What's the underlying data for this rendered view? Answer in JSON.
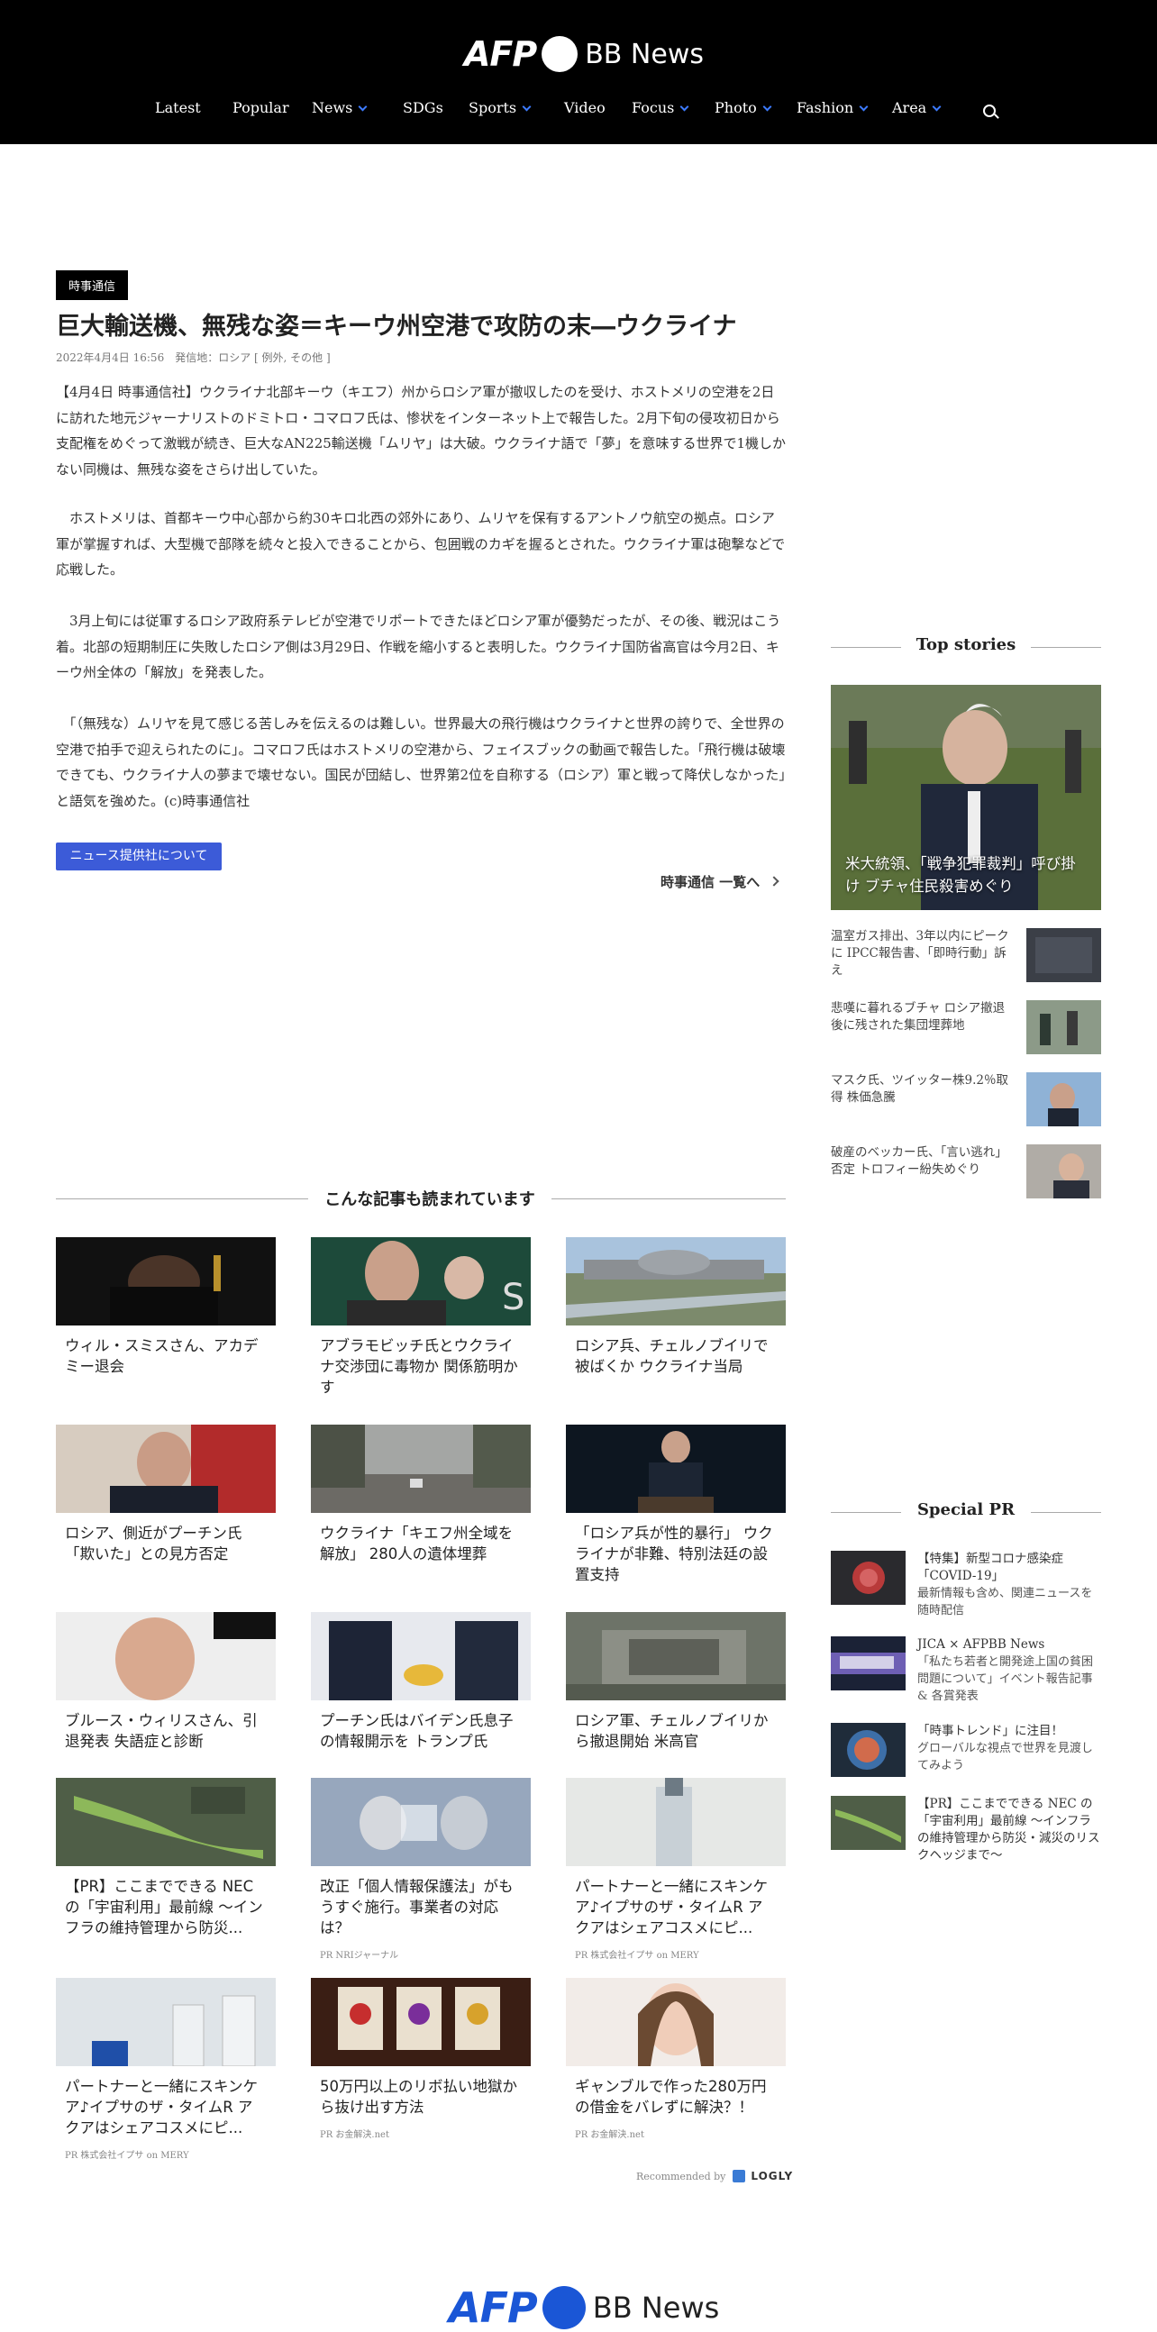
{
  "brand": {
    "afp": "AFP",
    "bb": "BB News"
  },
  "nav": [
    {
      "label": "Latest",
      "dropdown": false
    },
    {
      "label": "Popular",
      "dropdown": false
    },
    {
      "label": "News",
      "dropdown": true
    },
    {
      "label": "SDGs",
      "dropdown": false
    },
    {
      "label": "Sports",
      "dropdown": true
    },
    {
      "label": "Video",
      "dropdown": false
    },
    {
      "label": "Focus",
      "dropdown": true
    },
    {
      "label": "Photo",
      "dropdown": true
    },
    {
      "label": "Fashion",
      "dropdown": true
    },
    {
      "label": "Area",
      "dropdown": true
    }
  ],
  "article": {
    "badge": "時事通信",
    "title": "巨大輸送機、無残な姿＝キーウ州空港で攻防の末―ウクライナ",
    "meta": "2022年4月4日 16:56　発信地：ロシア [ 例外, その他 ]",
    "paragraphs": [
      "【4月4日 時事通信社】ウクライナ北部キーウ（キエフ）州からロシア軍が撤収したのを受け、ホストメリの空港を2日に訪れた地元ジャーナリストのドミトロ・コマロフ氏は、惨状をインターネット上で報告した。2月下旬の侵攻初日から支配権をめぐって激戦が続き、巨大なAN225輸送機「ムリヤ」は大破。ウクライナ語で「夢」を意味する世界で1機しかない同機は、無残な姿をさらけ出していた。",
      "　ホストメリは、首都キーウ中心部から約30キロ北西の郊外にあり、ムリヤを保有するアントノウ航空の拠点。ロシア軍が掌握すれば、大型機で部隊を続々と投入できることから、包囲戦のカギを握るとされた。ウクライナ軍は砲撃などで応戦した。",
      "　3月上旬には従軍するロシア政府系テレビが空港でリポートできたほどロシア軍が優勢だったが、その後、戦況はこう着。北部の短期制圧に失敗したロシア側は3月29日、作戦を縮小すると表明した。ウクライナ国防省高官は今月2日、キーウ州全体の「解放」を発表した。",
      "　「（無残な）ムリヤを見て感じる苦しみを伝えるのは難しい。世界最大の飛行機はウクライナと世界の誇りで、全世界の空港で拍手で迎えられたのに」。コマロフ氏はホストメリの空港から、フェイスブックの動画で報告した。「飛行機は破壊できても、ウクライナ人の夢まで壊せない。国民が団結し、世界第2位を自称する（ロシア）軍と戦って降伏しなかった」と語気を強めた。(c)時事通信社"
    ],
    "provider_button": "ニュース提供社について",
    "more_link": "時事通信 一覧へ"
  },
  "related": {
    "heading": "こんな記事も読まれています",
    "cards": [
      {
        "title": "ウィル・スミスさん、アカデミー退会",
        "source": ""
      },
      {
        "title": "アブラモビッチ氏とウクライナ交渉団に毒物か 関係筋明かす",
        "source": ""
      },
      {
        "title": "ロシア兵、チェルノブイリで被ばくか ウクライナ当局",
        "source": ""
      },
      {
        "title": "ロシア、側近がプーチン氏「欺いた」との見方否定",
        "source": ""
      },
      {
        "title": "ウクライナ「キエフ州全域を解放」 280人の遺体埋葬",
        "source": ""
      },
      {
        "title": "「ロシア兵が性的暴行」 ウクライナが非難、特別法廷の設置支持",
        "source": ""
      },
      {
        "title": "ブルース・ウィリスさん、引退発表 失語症と診断",
        "source": ""
      },
      {
        "title": "プーチン氏はバイデン氏息子の情報開示を トランプ氏",
        "source": ""
      },
      {
        "title": "ロシア軍、チェルノブイリから撤退開始 米高官",
        "source": ""
      },
      {
        "title": "【PR】ここまでできる NEC の「宇宙利用」最前線 ～インフラの維持管理から防災...",
        "source": ""
      },
      {
        "title": "改正「個人情報保護法」がもうすぐ施行。事業者の対応は？",
        "source": "PR NRIジャーナル"
      },
      {
        "title": "パートナーと一緒にスキンケア♪イプサのザ・タイムR アクアはシェアコスメにピ...",
        "source": "PR 株式会社イプサ on MERY"
      },
      {
        "title": "パートナーと一緒にスキンケア♪イプサのザ・タイムR アクアはシェアコスメにピ...",
        "source": "PR 株式会社イプサ on MERY"
      },
      {
        "title": "50万円以上のリボ払い地獄から抜け出す方法",
        "source": "PR お金解決.net"
      },
      {
        "title": "ギャンブルで作った280万円の借金をバレずに解決？！",
        "source": "PR お金解決.net"
      }
    ],
    "recommended_by": "Recommended by",
    "logly": "LOGLY"
  },
  "sidebar": {
    "top_stories_heading": "Top stories",
    "hero_caption": "米大統領、「戦争犯罪裁判」呼び掛け ブチャ住民殺害めぐり",
    "items": [
      {
        "title": "温室ガス排出、3年以内にピークに IPCC報告書、「即時行動」訴え"
      },
      {
        "title": "悲嘆に暮れるブチャ ロシア撤退後に残された集団埋葬地"
      },
      {
        "title": "マスク氏、ツイッター株9.2％取得 株価急騰"
      },
      {
        "title": "破産のベッカー氏、「言い逃れ」否定 トロフィー紛失めぐり"
      }
    ],
    "special_pr_heading": "Special PR",
    "pr_items": [
      {
        "title": "【特集】新型コロナ感染症「COVID-19」",
        "sub": "最新情報も含め、関連ニュースを随時配信"
      },
      {
        "title": "JICA × AFPBB News",
        "sub": "「私たち若者と開発途上国の貧困問題について」イベント報告記事 & 各賞発表"
      },
      {
        "title": "「時事トレンド」に注目！",
        "sub": "グローバルな視点で世界を見渡してみよう"
      },
      {
        "title": "【PR】ここまでできる NEC の「宇宙利用」最前線 ～インフラの維持管理から防災・減災のリスクヘッジまで～",
        "sub": ""
      }
    ]
  }
}
